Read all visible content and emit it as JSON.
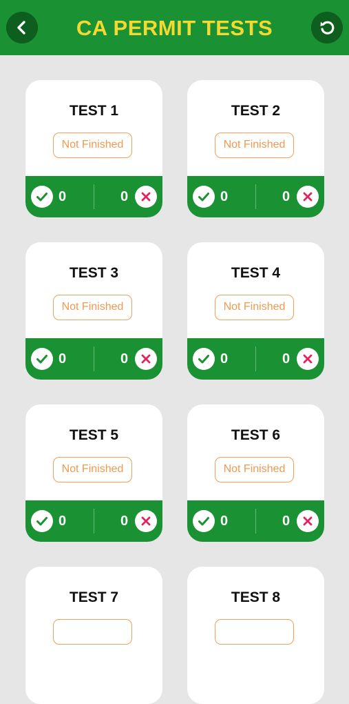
{
  "header": {
    "title": "CA PERMIT TESTS",
    "back_icon": "chevron-left-icon",
    "reset_icon": "refresh-icon"
  },
  "colors": {
    "primary": "#1a9132",
    "primary_dark": "#0e5e1f",
    "title": "#f5d933",
    "status": "#ee9a52",
    "wrong": "#e0245e",
    "background": "#e6e6e6"
  },
  "tests": [
    {
      "title": "TEST 1",
      "status": "Not Finished",
      "correct": "0",
      "wrong": "0"
    },
    {
      "title": "TEST 2",
      "status": "Not Finished",
      "correct": "0",
      "wrong": "0"
    },
    {
      "title": "TEST 3",
      "status": "Not Finished",
      "correct": "0",
      "wrong": "0"
    },
    {
      "title": "TEST 4",
      "status": "Not Finished",
      "correct": "0",
      "wrong": "0"
    },
    {
      "title": "TEST 5",
      "status": "Not Finished",
      "correct": "0",
      "wrong": "0"
    },
    {
      "title": "TEST 6",
      "status": "Not Finished",
      "correct": "0",
      "wrong": "0"
    },
    {
      "title": "TEST 7"
    },
    {
      "title": "TEST 8"
    }
  ]
}
